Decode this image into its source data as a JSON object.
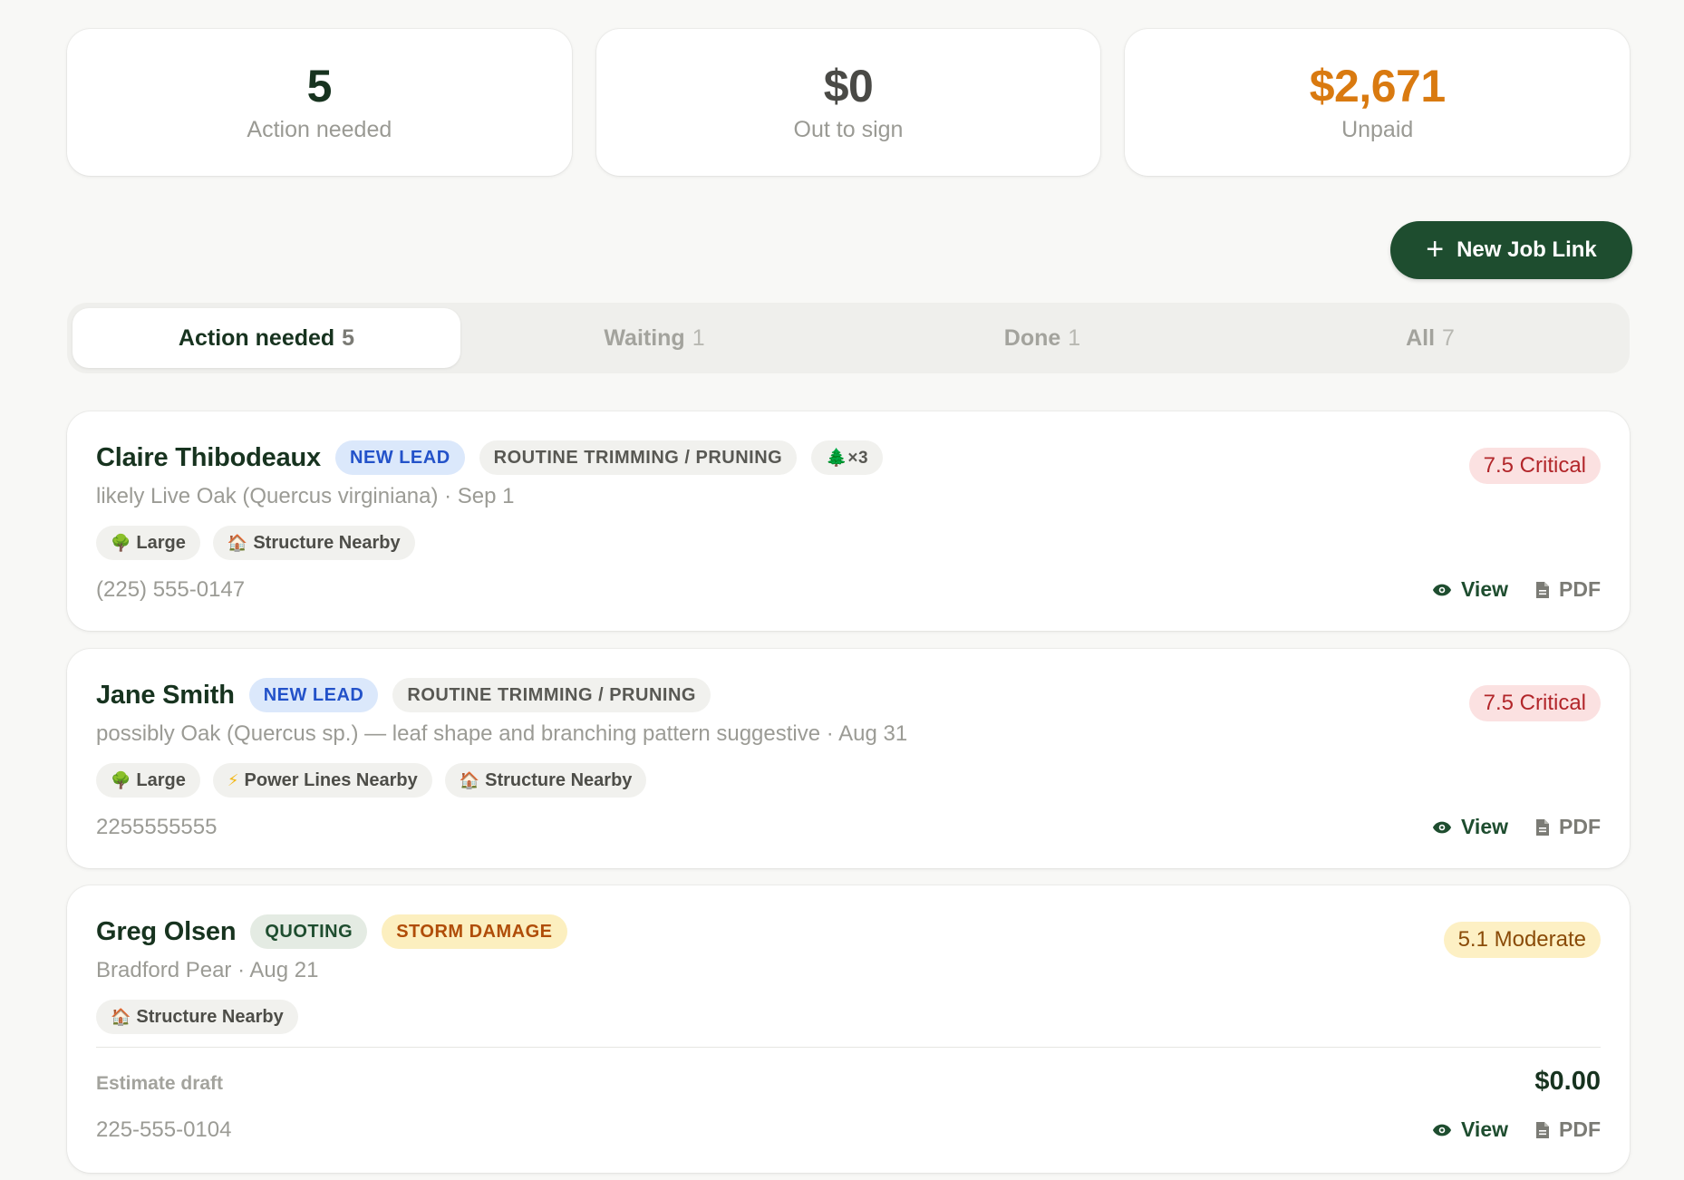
{
  "stats": [
    {
      "value": "5",
      "label": "Action needed"
    },
    {
      "value": "$0",
      "label": "Out to sign"
    },
    {
      "value": "$2,671",
      "label": "Unpaid"
    }
  ],
  "new_job_link": {
    "label": "New Job Link",
    "icon": "plus-icon"
  },
  "tabs": [
    {
      "label": "Action needed",
      "count": "5",
      "active": true
    },
    {
      "label": "Waiting",
      "count": "1",
      "active": false
    },
    {
      "label": "Done",
      "count": "1",
      "active": false
    },
    {
      "label": "All",
      "count": "7",
      "active": false
    }
  ],
  "jobs": [
    {
      "name": "Claire Thibodeaux",
      "status": "NEW LEAD",
      "service": "ROUTINE TRIMMING / PRUNING",
      "tree_count": "🌲×3",
      "severity": "7.5 Critical",
      "subtitle": "likely Live Oak (Quercus virginiana) · Sep 1",
      "tags": [
        {
          "icon": "🌳",
          "label": "Large"
        },
        {
          "icon": "🏠",
          "label": "Structure Nearby"
        }
      ],
      "phone": "(225) 555-0147",
      "view_label": "View",
      "pdf_label": "PDF"
    },
    {
      "name": "Jane Smith",
      "status": "NEW LEAD",
      "service": "ROUTINE TRIMMING / PRUNING",
      "severity": "7.5 Critical",
      "subtitle": "possibly Oak (Quercus sp.) — leaf shape and branching pattern suggestive · Aug 31",
      "tags": [
        {
          "icon": "🌳",
          "label": "Large"
        },
        {
          "icon": "⚡",
          "label": "Power Lines Nearby"
        },
        {
          "icon": "🏠",
          "label": "Structure Nearby"
        }
      ],
      "phone": "2255555555",
      "view_label": "View",
      "pdf_label": "PDF"
    },
    {
      "name": "Greg Olsen",
      "status": "QUOTING",
      "service": "STORM DAMAGE",
      "severity": "5.1 Moderate",
      "subtitle": "Bradford Pear · Aug 21",
      "tags": [
        {
          "icon": "🏠",
          "label": "Structure Nearby"
        }
      ],
      "estimate_label": "Estimate draft",
      "estimate_amount": "$0.00",
      "phone": "225-555-0104",
      "view_label": "View",
      "pdf_label": "PDF"
    }
  ],
  "colors": {
    "brand_green": "#1e4d2f",
    "unpaid_orange": "#d97a10",
    "critical_red": "#b2262a",
    "moderate_amber": "#8a4b08",
    "new_lead_blue": "#2352c9"
  }
}
